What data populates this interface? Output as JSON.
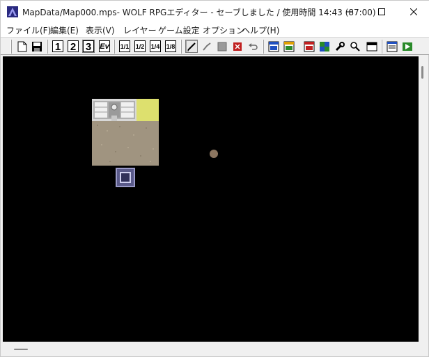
{
  "window": {
    "title": "MapData/Map000.mps- WOLF RPGエディター - セーブしました / 使用時間 14:43 (87:00)"
  },
  "menu": {
    "items": [
      {
        "label": "ファイル(F)"
      },
      {
        "label": "編集(E)"
      },
      {
        "label": "表示(V)"
      },
      {
        "label": "レイヤー"
      },
      {
        "label": "ゲーム設定"
      },
      {
        "label": "オプション"
      },
      {
        "label": "ヘルプ(H)"
      }
    ]
  },
  "toolbar": {
    "layer_buttons": [
      "1",
      "2",
      "3"
    ],
    "event_button": "Ev",
    "zoom_buttons": [
      "1/1",
      "1/2",
      "1/4",
      "1/8"
    ],
    "selected_layer": "3"
  },
  "canvas": {
    "background": "#000000"
  },
  "colors": {
    "accent": "#5a5ac8",
    "yellow_tile": "#dde06e",
    "ground_tile": "#a09480"
  }
}
